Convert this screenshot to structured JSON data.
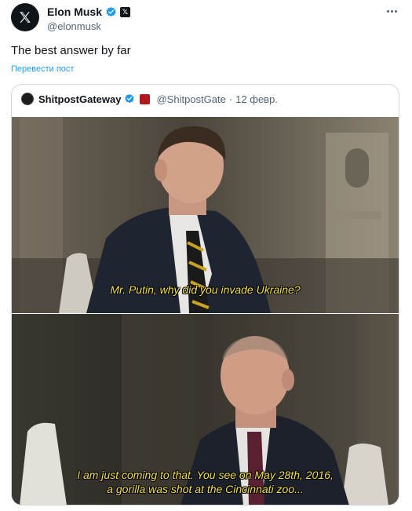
{
  "author": {
    "name": "Elon Musk",
    "handle": "@elonmusk",
    "avatar_icon": "x-logo-icon",
    "verified_color": "#1d9bf0"
  },
  "tweet": {
    "text": "The best answer by far",
    "translate_label": "Перевести пост"
  },
  "quote": {
    "name": "ShitpostGateway",
    "handle": "@ShitpostGate",
    "separator": "·",
    "date": "12 февр.",
    "subtitle_top": "Mr. Putin, why did you invade Ukraine?",
    "subtitle_bottom_line1": "I am just coming to that. You see on May 28th, 2016,",
    "subtitle_bottom_line2": "a gorilla was shot at the Cincinnati zoo..."
  },
  "colors": {
    "accent": "#1d9bf0",
    "subtitle": "#f4e04d"
  }
}
